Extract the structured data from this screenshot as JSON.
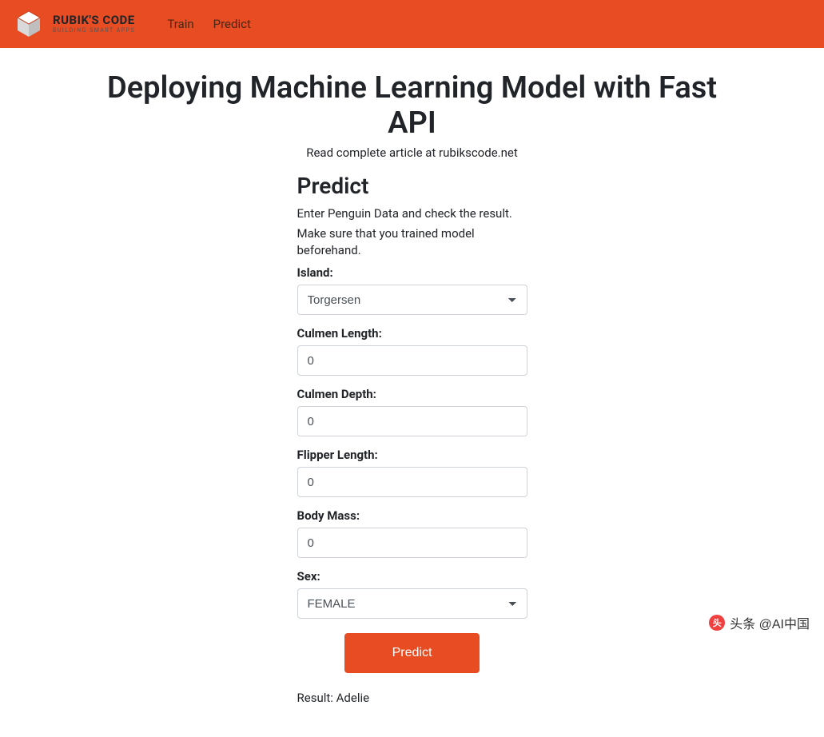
{
  "navbar": {
    "brand_title": "RUBIK'S CODE",
    "brand_sub": "BUILDING SMART APPS",
    "links": [
      {
        "label": "Train"
      },
      {
        "label": "Predict"
      }
    ]
  },
  "header": {
    "title": "Deploying Machine Learning Model with Fast API",
    "subtitle": "Read complete article at rubikscode.net"
  },
  "form": {
    "title": "Predict",
    "desc_line1": "Enter Penguin Data and check the result.",
    "desc_line2": "Make sure that you trained model beforehand.",
    "island": {
      "label": "Island:",
      "value": "Torgersen"
    },
    "culmen_length": {
      "label": "Culmen Length:",
      "value": "0"
    },
    "culmen_depth": {
      "label": "Culmen Depth:",
      "value": "0"
    },
    "flipper_length": {
      "label": "Flipper Length:",
      "value": "0"
    },
    "body_mass": {
      "label": "Body Mass:",
      "value": "0"
    },
    "sex": {
      "label": "Sex:",
      "value": "FEMALE"
    },
    "submit_label": "Predict",
    "result": "Result: Adelie"
  },
  "watermark": {
    "badge": "头条",
    "text": "头条 @AI中国"
  }
}
